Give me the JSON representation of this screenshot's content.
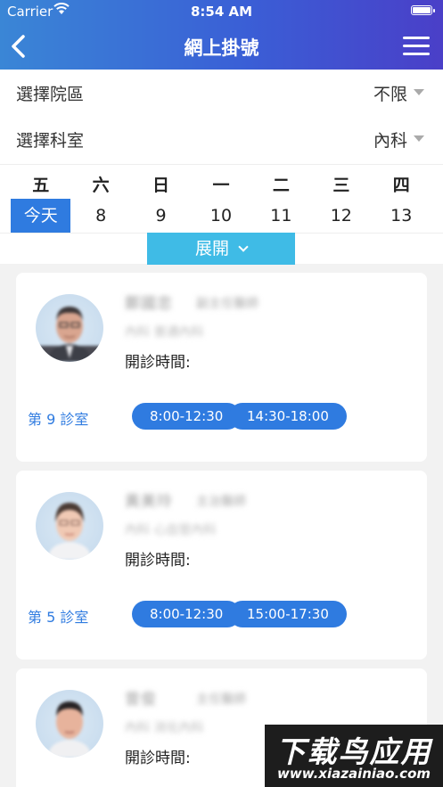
{
  "status_bar": {
    "carrier": "Carrier",
    "time": "8:54 AM"
  },
  "nav": {
    "title": "網上掛號",
    "back_icon": "chevron-left-icon",
    "menu_icon": "hamburger-menu-icon"
  },
  "filters": [
    {
      "label": "選擇院區",
      "value": "不限"
    },
    {
      "label": "選擇科室",
      "value": "內科"
    }
  ],
  "calendar": {
    "weekdays": [
      "五",
      "六",
      "日",
      "一",
      "二",
      "三",
      "四"
    ],
    "dates": [
      "今天",
      "8",
      "9",
      "10",
      "11",
      "12",
      "13"
    ],
    "selected_index": 0,
    "expand_label": "展開"
  },
  "doctors": [
    {
      "name": "鄭國忠",
      "title": "副主任醫師",
      "specialty": "內科 普通內科",
      "hours_label": "開診時間:",
      "room": "第 9 診室",
      "slots": [
        "8:00-12:30",
        "14:30-18:00"
      ]
    },
    {
      "name": "黃美玲",
      "title": "主治醫師",
      "specialty": "內科 心血管內科",
      "hours_label": "開診時間:",
      "room": "第 5 診室",
      "slots": [
        "8:00-12:30",
        "15:00-17:30"
      ]
    },
    {
      "name": "曾俊",
      "title": "主任醫師",
      "specialty": "內科 消化內科",
      "hours_label": "開診時間:"
    }
  ],
  "watermark": {
    "main": "下载鸟应用",
    "url": "www.xiazainiao.com"
  },
  "colors": {
    "accent": "#2f7be0",
    "expand": "#3fbbe6",
    "header_start": "#3a86d6",
    "header_end": "#4a3fc8"
  }
}
